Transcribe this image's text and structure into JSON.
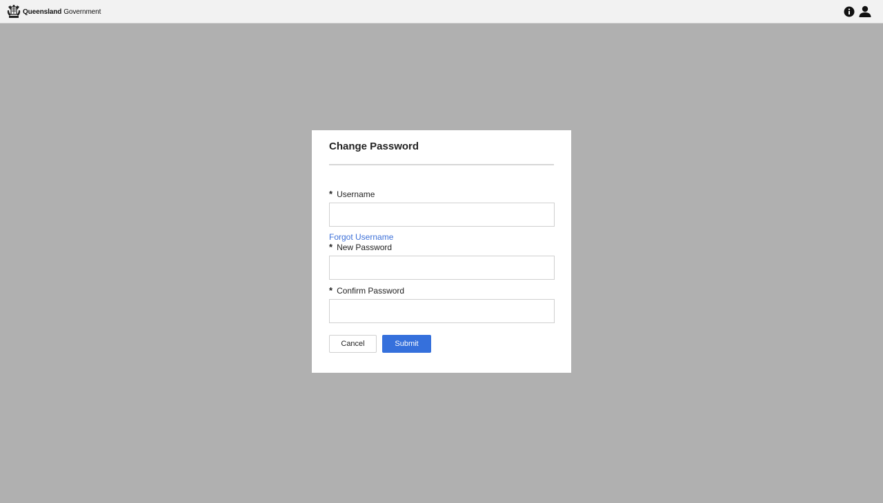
{
  "header": {
    "brand_bold": "Queensland",
    "brand_regular": "Government",
    "icons": [
      "info-icon",
      "user-icon"
    ]
  },
  "modal": {
    "title": "Change Password",
    "required_marker": "*",
    "username_label": "Username",
    "username_value": "",
    "forgot_username_link": "Forgot Username",
    "new_password_label": "New Password",
    "new_password_value": "",
    "confirm_password_label": "Confirm Password",
    "confirm_password_value": "",
    "cancel_label": "Cancel",
    "submit_label": "Submit"
  },
  "colors": {
    "overlay_background": "#b0b0b0",
    "header_background": "#f2f2f2",
    "link": "#3b6fd8",
    "primary_button": "#3570dc"
  }
}
